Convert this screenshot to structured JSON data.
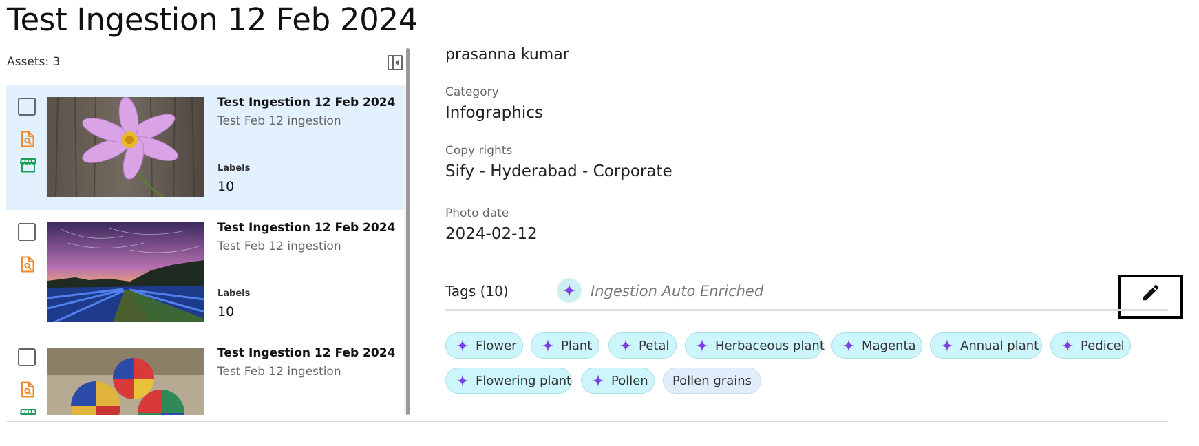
{
  "page": {
    "title": "Test Ingestion 12 Feb 2024"
  },
  "list": {
    "assets_count": "Assets: 3",
    "items": [
      {
        "title": "Test Ingestion 12 Feb 2024",
        "subtitle": "Test Feb 12 ingestion",
        "labels_label": "Labels",
        "labels_value": "10",
        "selected": true,
        "thumbnail": "pink-cosmos-flower-photo"
      },
      {
        "title": "Test Ingestion 12 Feb 2024",
        "subtitle": "Test Feb 12 ingestion",
        "labels_label": "Labels",
        "labels_value": "10",
        "selected": false,
        "thumbnail": "star-trail-field-photo"
      },
      {
        "title": "Test Ingestion 12 Feb 2024",
        "subtitle": "Test Feb 12 ingestion",
        "selected": false,
        "thumbnail": "colorful-juggling-balls-photo"
      }
    ]
  },
  "details": {
    "owner": "prasanna kumar",
    "category_label": "Category",
    "category_value": "Infographics",
    "copyrights_label": "Copy rights",
    "copyrights_value": "Sify - Hyderabad - Corporate",
    "photodate_label": "Photo date",
    "photodate_value": "2024-02-12"
  },
  "tags": {
    "heading": "Tags (10)",
    "ai_label": "Ingestion Auto Enriched",
    "items": [
      "Flower",
      "Plant",
      "Petal",
      "Herbaceous plant",
      "Magenta",
      "Annual plant",
      "Pedicel",
      "Flowering plant",
      "Pollen",
      "Pollen grains"
    ]
  },
  "icons": {
    "file_search": "file-search-icon",
    "store": "store-icon",
    "sparkle": "sparkle-icon",
    "edit": "pencil-icon",
    "collapse": "panel-collapse-icon"
  },
  "colors": {
    "selected_bg": "#e3f0fd",
    "orange_icon": "#f08a2c",
    "green_icon": "#1e9e5a",
    "sparkle": "#7b3fe4",
    "chip_bg": "#cdf5fc",
    "chip_plain_bg": "#e2edfb"
  }
}
